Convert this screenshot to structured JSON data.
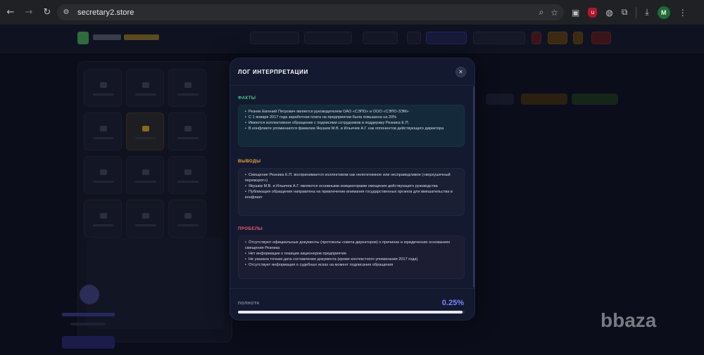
{
  "browser": {
    "url": "secretary2.store",
    "back_icon": "arrow-left-icon",
    "forward_icon": "arrow-right-icon",
    "reload_icon": "reload-icon",
    "site_info_icon": "site-info-icon",
    "zoom_icon": "zoom-icon",
    "bookmark_icon": "star-icon",
    "profile_letter": "M"
  },
  "modal": {
    "title": "ЛОГ ИНТЕРПРЕТАЦИИ",
    "close_glyph": "✕",
    "sections": {
      "facts": {
        "heading": "ФАКТЫ",
        "color": "#4ec98a",
        "items": [
          "Резник Евгений Петрович является руководителем ОАО «СЭПО» и ООО «СЭПО-ЗЭМ»",
          "С 1 января 2017 года заработная плата на предприятии была повышена на 20%",
          "Имеются коллективное обращение с подписями сотрудников в поддержку Резника Е.П.",
          "В конфликте упоминаются фамилии Якушев М.В. и Ильичев А.Г. как оппонентов действующего директора"
        ]
      },
      "conclusions": {
        "heading": "ВЫВОДЫ",
        "color": "#f0a23a",
        "items": [
          "Смещение Резника Е.П. воспринимается коллективом как нелегитимное или несправедливое («верхушечный переворот»)",
          "Якушев М.В. и Ильичев А.Г. являются основными инициаторами смещения действующего руководства",
          "Публикация обращения направлена на привлечение внимания государственных органов для вмешательства в конфликт"
        ]
      },
      "gaps": {
        "heading": "ПРОБЕЛЫ",
        "color": "#ee5a6a",
        "items": [
          "Отсутствуют официальные документы (протоколы совета директоров) о причинах и юридических основаниях смещения Резника",
          "Нет информации о позиции акционеров предприятия",
          "Не указана точная дата составления документа (кроме контекстного упоминания 2017 года)",
          "Отсутствует информация о судебных исках на момент подписания обращения"
        ]
      }
    },
    "completeness": {
      "label": "ПОЛНОТА",
      "value_text": "0.25%",
      "fraction": 0.99
    }
  },
  "watermark": "bbaza"
}
